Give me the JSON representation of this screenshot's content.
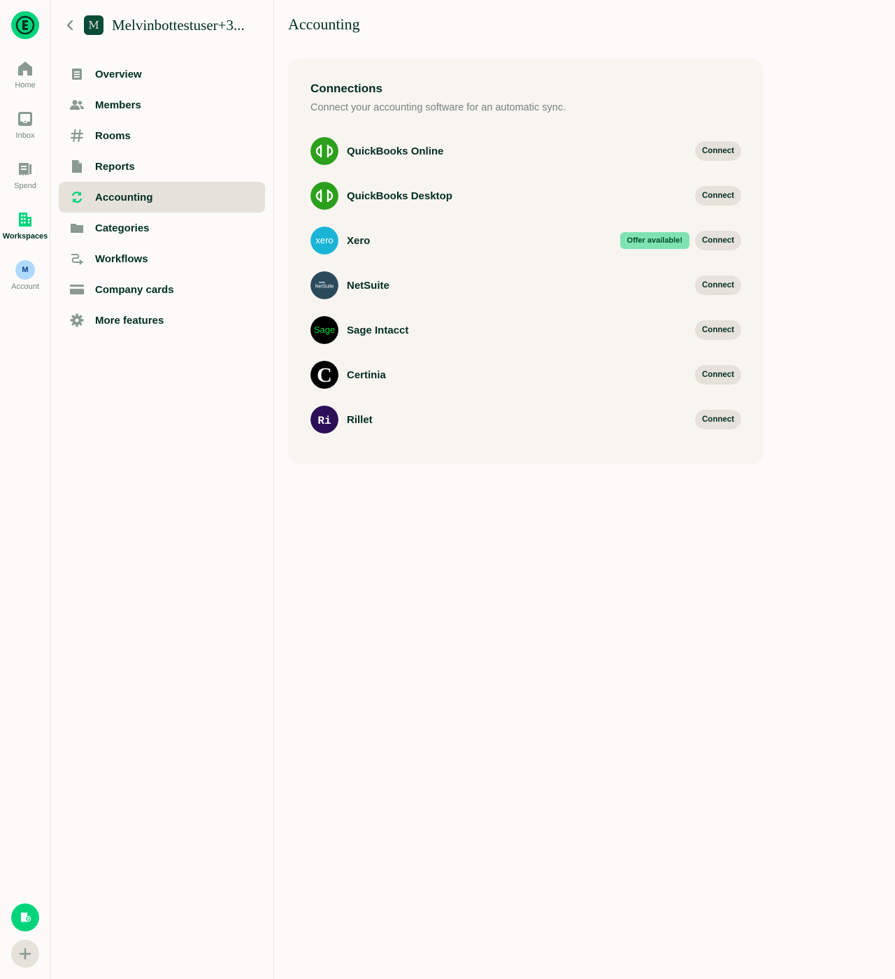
{
  "rail": {
    "items": [
      {
        "label": "Home",
        "icon": "home-icon"
      },
      {
        "label": "Inbox",
        "icon": "inbox-icon"
      },
      {
        "label": "Spend",
        "icon": "receipt-icon"
      },
      {
        "label": "Workspaces",
        "icon": "building-icon"
      },
      {
        "label": "Account",
        "icon": "avatar",
        "initial": "M"
      }
    ],
    "active": "Workspaces"
  },
  "sidebar": {
    "workspace_initial": "M",
    "workspace_name": "Melvinbottestuser+3...",
    "items": [
      {
        "label": "Overview",
        "icon": "document-icon"
      },
      {
        "label": "Members",
        "icon": "users-icon"
      },
      {
        "label": "Rooms",
        "icon": "hashtag-icon"
      },
      {
        "label": "Reports",
        "icon": "file-icon"
      },
      {
        "label": "Accounting",
        "icon": "sync-icon"
      },
      {
        "label": "Categories",
        "icon": "folder-icon"
      },
      {
        "label": "Workflows",
        "icon": "workflow-icon"
      },
      {
        "label": "Company cards",
        "icon": "credit-card-icon"
      },
      {
        "label": "More features",
        "icon": "gear-icon"
      }
    ],
    "active": "Accounting"
  },
  "main": {
    "title": "Accounting",
    "card": {
      "title": "Connections",
      "subtitle": "Connect your accounting software for an automatic sync.",
      "button_label": "Connect",
      "offer_label": "Offer available!",
      "connections": [
        {
          "name": "QuickBooks Online",
          "logo": "quickbooks-logo",
          "logo_text": ""
        },
        {
          "name": "QuickBooks Desktop",
          "logo": "quickbooks-logo",
          "logo_text": ""
        },
        {
          "name": "Xero",
          "logo": "xero-logo",
          "logo_text": "xero",
          "offer": true
        },
        {
          "name": "NetSuite",
          "logo": "netsuite-logo",
          "logo_text": "NetSuite"
        },
        {
          "name": "Sage Intacct",
          "logo": "sage-logo",
          "logo_text": "Sage"
        },
        {
          "name": "Certinia",
          "logo": "certinia-logo",
          "logo_text": "C"
        },
        {
          "name": "Rillet",
          "logo": "rillet-logo",
          "logo_text": "Ri"
        }
      ]
    }
  },
  "colors": {
    "brand_green": "#03d47c",
    "dark_text": "#002e22",
    "muted_text": "#76847e",
    "active_bg": "#e6e1da",
    "card_bg": "#f8f4f0"
  }
}
